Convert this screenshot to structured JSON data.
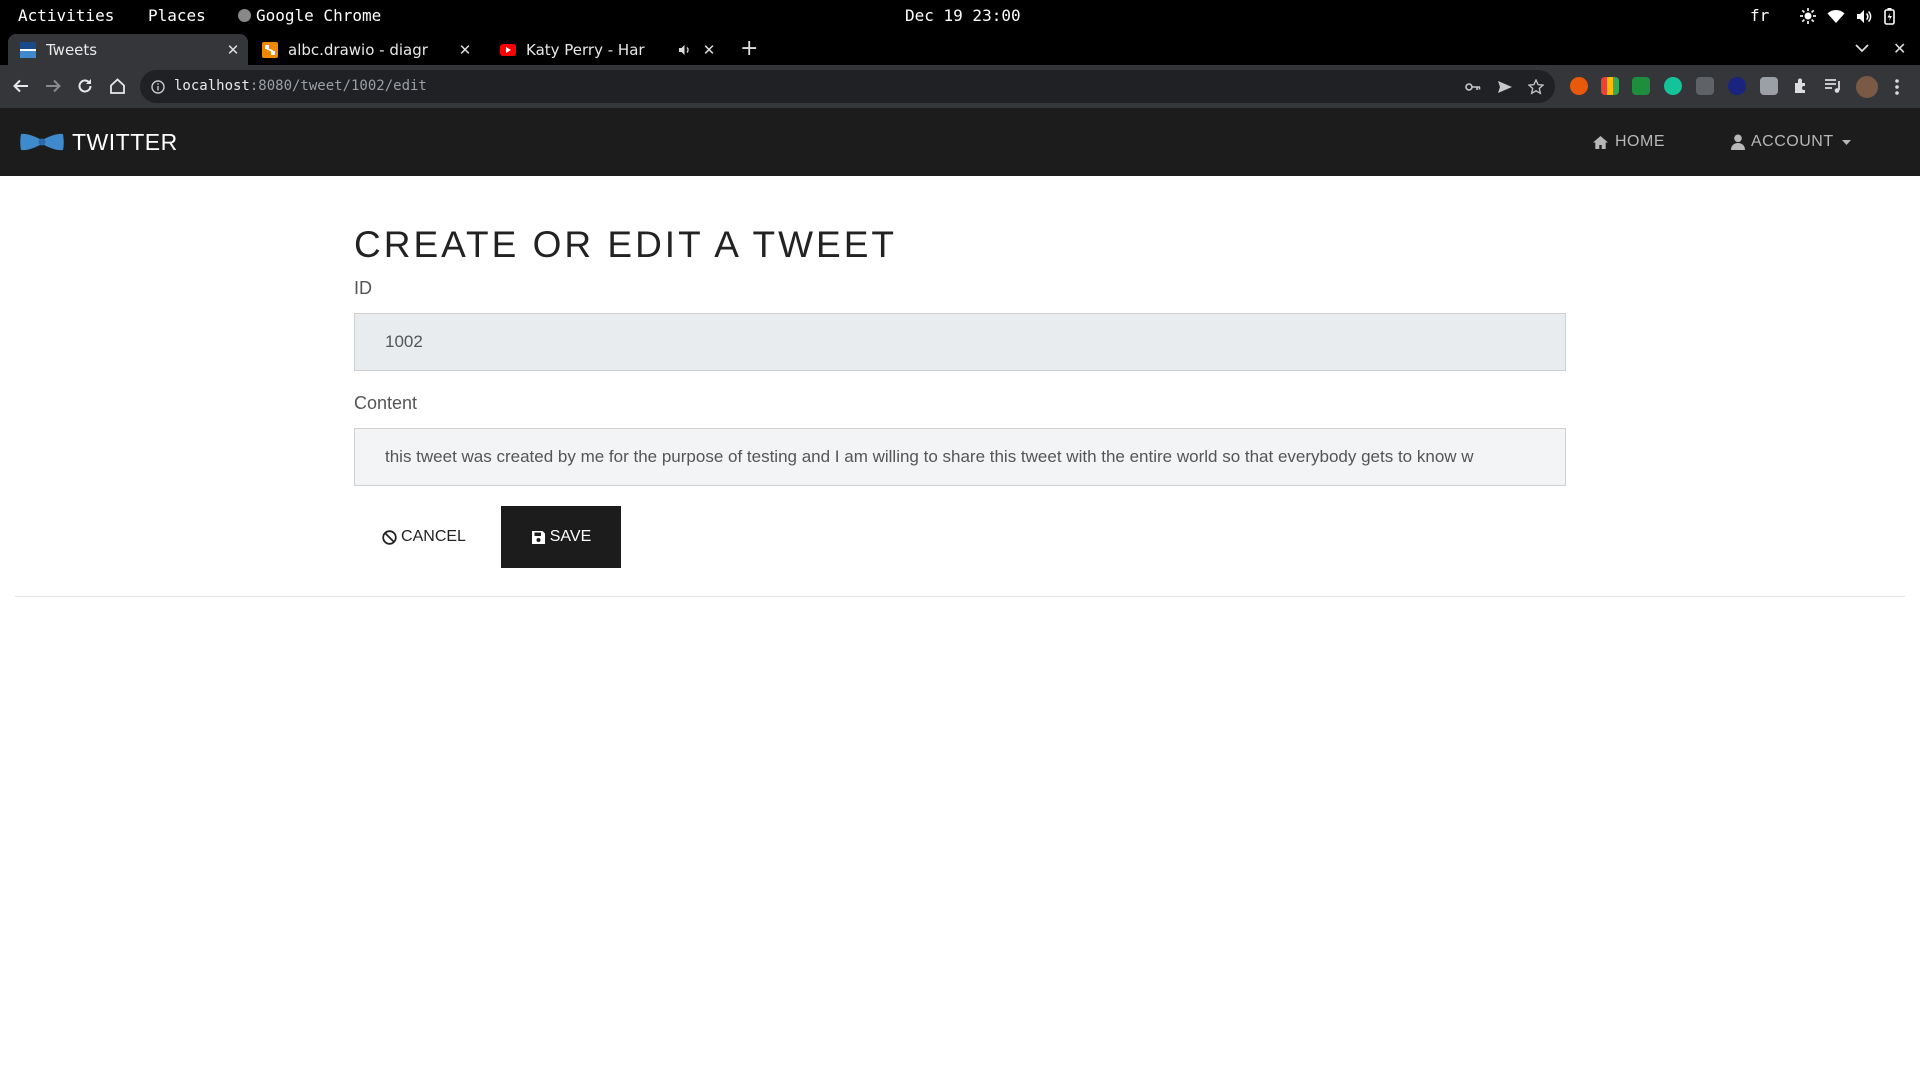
{
  "system_bar": {
    "activities": "Activities",
    "places": "Places",
    "app_name": "Google Chrome",
    "clock": "Dec 19 23:00",
    "keyboard_layout": "fr"
  },
  "browser": {
    "tabs": [
      {
        "title": "Tweets",
        "active": true,
        "icon": "jhipster-favicon"
      },
      {
        "title": "albc.drawio - diagr",
        "active": false,
        "icon": "drawio-favicon"
      },
      {
        "title": "Katy Perry - Har",
        "active": false,
        "icon": "youtube-favicon",
        "audio": true
      }
    ],
    "new_tab_label": "+",
    "url": {
      "host": "localhost",
      "rest": ":8080/tweet/1002/edit"
    }
  },
  "app": {
    "brand": "TWITTER",
    "nav": {
      "home": "HOME",
      "account": "ACCOUNT"
    }
  },
  "form": {
    "heading": "CREATE OR EDIT A TWEET",
    "id_label": "ID",
    "id_value": "1002",
    "content_label": "Content",
    "content_value": "this tweet was created by me for the purpose of testing and I am willing to share this tweet with the entire world so that everybody gets to know w",
    "cancel_label": "CANCEL",
    "save_label": "SAVE"
  },
  "colors": {
    "navbar_bg": "#1c1c1c",
    "save_bg": "#1c1c1c",
    "brand_logo": "#3e8acc"
  }
}
